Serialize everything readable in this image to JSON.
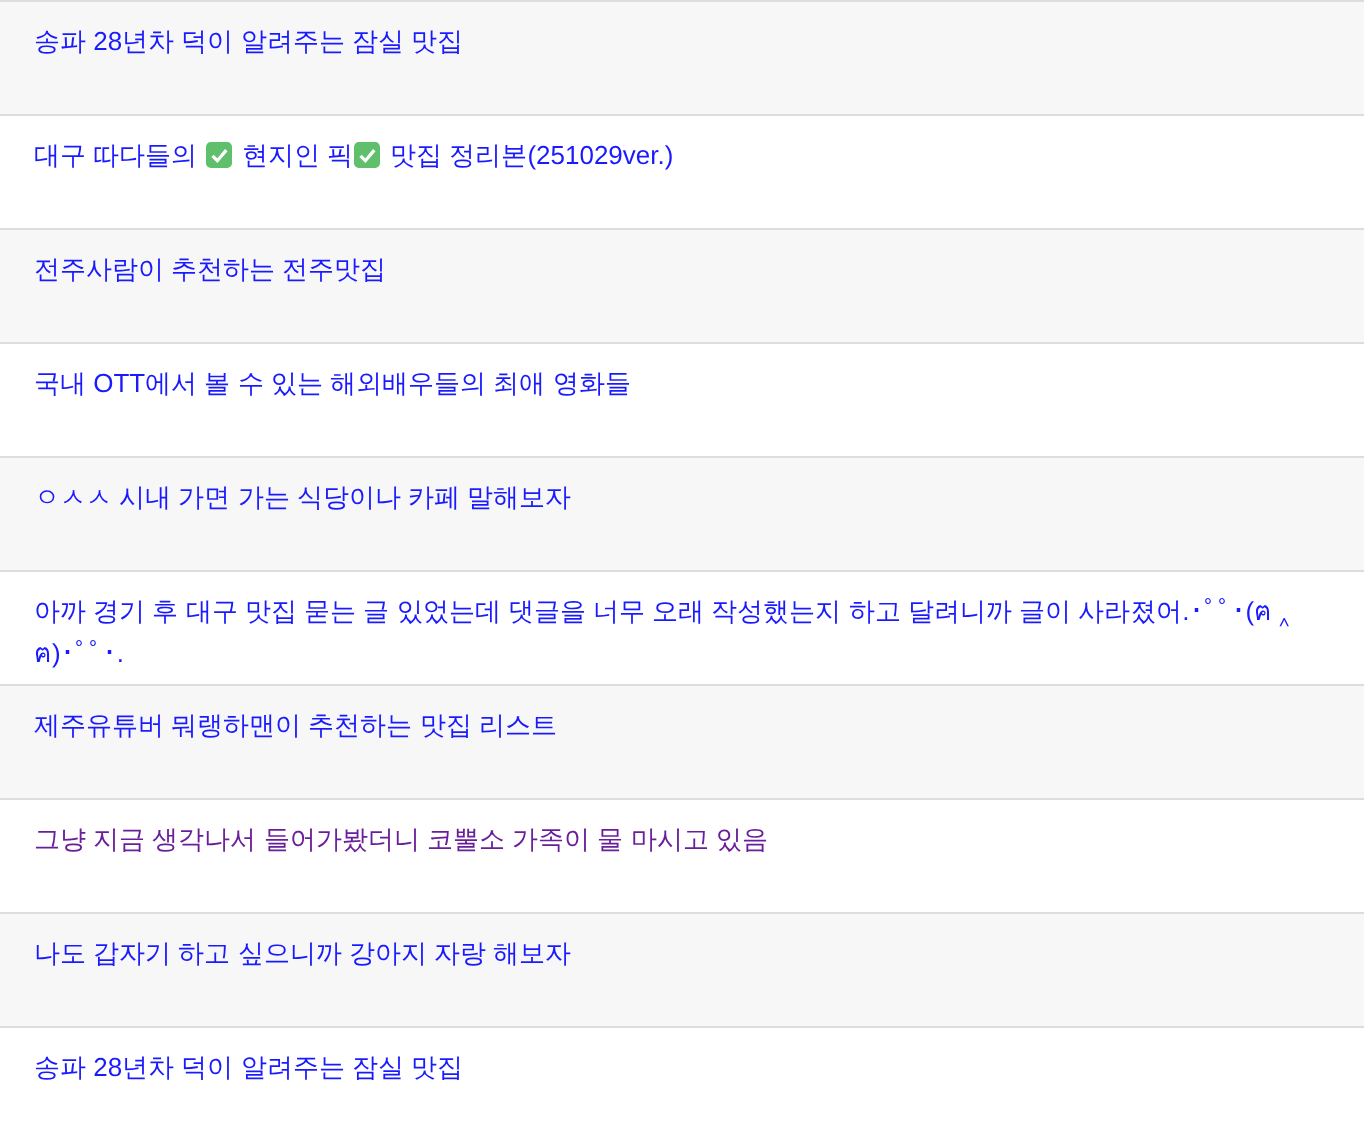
{
  "posts": [
    {
      "parts": [
        {
          "kind": "text",
          "text": "송파 28년차 덕이 알려주는 잠실 맛집"
        }
      ],
      "visited": false
    },
    {
      "parts": [
        {
          "kind": "text",
          "text": "대구 따다들의 "
        },
        {
          "kind": "check"
        },
        {
          "kind": "text",
          "text": " 현지인 픽"
        },
        {
          "kind": "check"
        },
        {
          "kind": "text",
          "text": " 맛집 정리본(251029ver.)"
        }
      ],
      "visited": false
    },
    {
      "parts": [
        {
          "kind": "text",
          "text": "전주사람이 추천하는 전주맛집"
        }
      ],
      "visited": false
    },
    {
      "parts": [
        {
          "kind": "text",
          "text": "국내 OTT에서 볼 수 있는 해외배우들의 최애 영화들"
        }
      ],
      "visited": false
    },
    {
      "parts": [
        {
          "kind": "text",
          "text": "ㅇㅅㅅ 시내 가면 가는 식당이나 카페 말해보자"
        }
      ],
      "visited": false
    },
    {
      "parts": [
        {
          "kind": "text",
          "text": "아까 경기 후 대구 맛집 묻는 글 있었는데 댓글을 너무 오래 작성했는지 하고 달려니까 글이 사라졌어.･ﾟﾟ･(ฅ ‸ ฅ)･ﾟﾟ･."
        }
      ],
      "visited": false
    },
    {
      "parts": [
        {
          "kind": "text",
          "text": "제주유튜버 뭐랭하맨이 추천하는 맛집 리스트"
        }
      ],
      "visited": false
    },
    {
      "parts": [
        {
          "kind": "text",
          "text": "그냥 지금 생각나서 들어가봤더니 코뿔소 가족이 물 마시고 있음"
        }
      ],
      "visited": true
    },
    {
      "parts": [
        {
          "kind": "text",
          "text": "나도 갑자기 하고 싶으니까 강아지 자랑 해보자"
        }
      ],
      "visited": false
    },
    {
      "parts": [
        {
          "kind": "text",
          "text": "송파 28년차 덕이 알려주는 잠실 맛집"
        }
      ],
      "visited": false
    }
  ]
}
